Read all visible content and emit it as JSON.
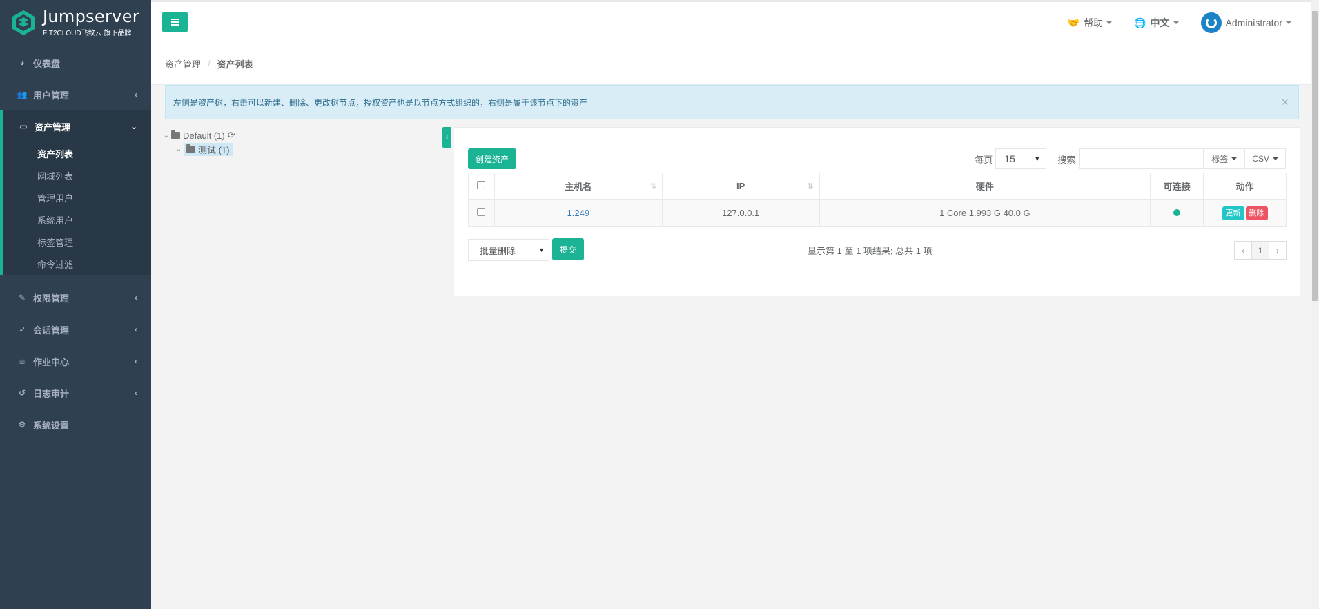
{
  "brand": {
    "name": "Jumpserver",
    "tagline": "FIT2CLOUD飞致云 旗下品牌"
  },
  "sidebar": {
    "items": [
      {
        "label": "仪表盘",
        "icon": "dashboard-icon"
      },
      {
        "label": "用户管理",
        "icon": "users-icon"
      },
      {
        "label": "资产管理",
        "icon": "inbox-icon",
        "active": true,
        "children": [
          {
            "label": "资产列表",
            "active": true
          },
          {
            "label": "网域列表"
          },
          {
            "label": "管理用户"
          },
          {
            "label": "系统用户"
          },
          {
            "label": "标签管理"
          },
          {
            "label": "命令过滤"
          }
        ]
      },
      {
        "label": "权限管理",
        "icon": "edit-icon"
      },
      {
        "label": "会话管理",
        "icon": "rocket-icon"
      },
      {
        "label": "作业中心",
        "icon": "coffee-icon"
      },
      {
        "label": "日志审计",
        "icon": "history-icon"
      },
      {
        "label": "系统设置",
        "icon": "gears-icon"
      }
    ]
  },
  "topbar": {
    "help": "帮助",
    "language": "中文",
    "user": "Administrator"
  },
  "breadcrumb": {
    "parent": "资产管理",
    "current": "资产列表"
  },
  "alert": {
    "text": "左侧是资产树，右击可以新建、删除、更改树节点，授权资产也是以节点方式组织的，右侧是属于该节点下的资产"
  },
  "tree": {
    "root": "Default (1)",
    "child": "测试 (1)"
  },
  "toolbar": {
    "create": "创建资产",
    "per_page_label": "每页",
    "per_page_value": "15",
    "search_label": "搜索",
    "search_value": "",
    "tags_button": "标签",
    "csv_button": "CSV"
  },
  "table": {
    "headers": {
      "hostname": "主机名",
      "ip": "IP",
      "hardware": "硬件",
      "connectable": "可连接",
      "actions": "动作"
    },
    "rows": [
      {
        "hostname": "1.249",
        "ip": "127.0.0.1",
        "hardware": "1 Core 1.993 G 40.0 G",
        "connectable": true,
        "update": "更新",
        "delete": "删除"
      }
    ]
  },
  "footer": {
    "bulk_action": "批量删除",
    "submit": "提交",
    "info": "显示第 1 至 1 项结果; 总共 1 项",
    "prev": "‹",
    "page": "1",
    "next": "›"
  },
  "colors": {
    "sidebar": "#2f4050",
    "accent": "#1ab394",
    "info": "#23c6c8",
    "danger": "#ed5565",
    "link": "#337ab7"
  }
}
